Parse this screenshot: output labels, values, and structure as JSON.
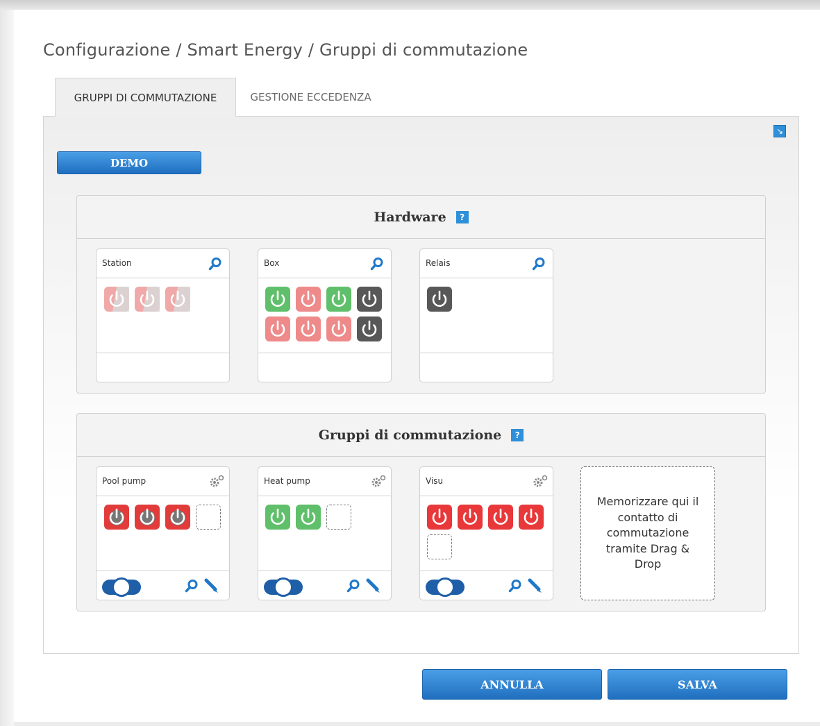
{
  "breadcrumb": "Configurazione / Smart Energy / Gruppi di commutazione",
  "tabs": [
    {
      "label": "GRUPPI DI COMMUTAZIONE",
      "active": true
    },
    {
      "label": "GESTIONE ECCEDENZA",
      "active": false
    }
  ],
  "demo_button": "DEMO",
  "hardware": {
    "title": "Hardware",
    "help": "?",
    "cards": [
      {
        "title": "Station",
        "icon": "search-icon",
        "contacts": [
          {
            "state": "faded-red"
          },
          {
            "state": "faded-red"
          },
          {
            "state": "faded-red"
          }
        ]
      },
      {
        "title": "Box",
        "icon": "search-icon",
        "contacts": [
          {
            "state": "green"
          },
          {
            "state": "red"
          },
          {
            "state": "green"
          },
          {
            "state": "dark"
          },
          {
            "state": "red"
          },
          {
            "state": "red"
          },
          {
            "state": "red"
          },
          {
            "state": "dark"
          }
        ]
      },
      {
        "title": "Relais",
        "icon": "search-icon",
        "contacts": [
          {
            "state": "dark"
          }
        ]
      }
    ]
  },
  "groups": {
    "title": "Gruppi di commutazione",
    "help": "?",
    "cards": [
      {
        "title": "Pool pump",
        "icon": "gear-icon",
        "contacts": [
          {
            "state": "red-dark"
          },
          {
            "state": "red-dark"
          },
          {
            "state": "red-dark"
          }
        ],
        "toggle": "on"
      },
      {
        "title": "Heat pump",
        "icon": "gear-icon",
        "contacts": [
          {
            "state": "green"
          },
          {
            "state": "green"
          }
        ],
        "toggle": "on"
      },
      {
        "title": "Visu",
        "icon": "gear-icon",
        "contacts": [
          {
            "state": "bright-red"
          },
          {
            "state": "bright-red"
          },
          {
            "state": "bright-red"
          },
          {
            "state": "bright-red"
          }
        ],
        "toggle": "on"
      }
    ],
    "drop_zone_text": "Memorizzare qui il contatto di commutazione tramite Drag & Drop"
  },
  "footer": {
    "cancel_label": "ANNULLA",
    "save_label": "SALVA"
  },
  "colors": {
    "accent": "#2f8fd8",
    "button_top": "#4a9ee6",
    "button_bottom": "#1f6fbf",
    "green": "#5cb85c",
    "red": "#d9534f",
    "dark": "#555555"
  }
}
